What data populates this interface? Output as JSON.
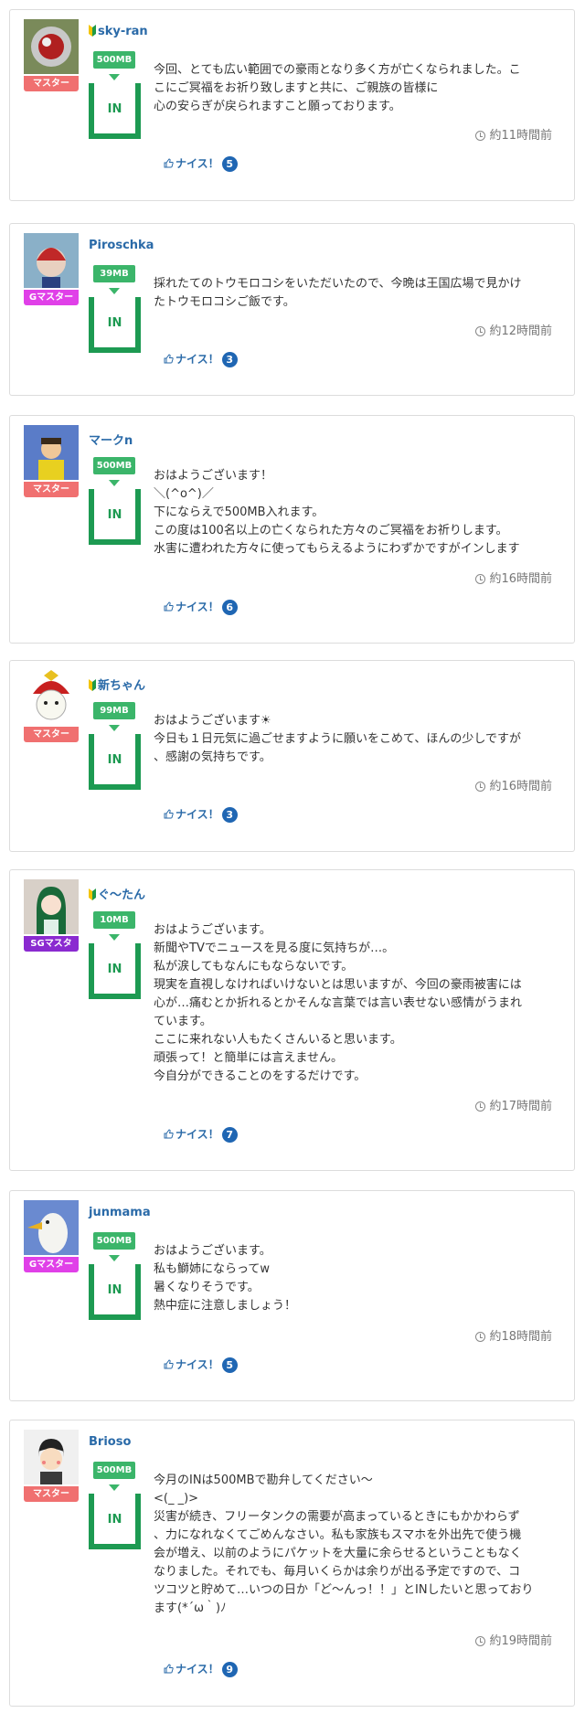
{
  "labels": {
    "nice": "ナイス！",
    "in": "IN"
  },
  "colors": {
    "master": "#f07070",
    "gmaster": "#e040e8",
    "sgmaster": "#8a2ad0",
    "in_green": "#1d9a52",
    "link_blue": "#2a6aa8"
  },
  "posts": [
    {
      "user": "sky-ran",
      "beginner": true,
      "rank": "マスター",
      "rank_color": "master",
      "mb": "500MB",
      "message": "今回、とても広い範囲での豪雨となり多く方が亡くなられました。こ\nこにご冥福をお祈り致しますと共に、ご親族の皆様に\n心の安らぎが戻られますこと願っております。",
      "time": "約11時間前",
      "nice_count": "5"
    },
    {
      "user": "Piroschka",
      "beginner": false,
      "rank": "Gマスター",
      "rank_color": "gmaster",
      "mb": "39MB",
      "message": "採れたてのトウモロコシをいただいたので、今晩は王国広場で見かけ\nたトウモロコシご飯です。",
      "time": "約12時間前",
      "nice_count": "3"
    },
    {
      "user": "マークn",
      "beginner": false,
      "rank": "マスター",
      "rank_color": "master",
      "mb": "500MB",
      "message": "おはようございます！\n＼(^o^)／\n下にならえで500MB入れます。\nこの度は100名以上の亡くなられた方々のご冥福をお祈りします。\n水害に遭われた方々に使ってもらえるようにわずかですがインします",
      "time": "約16時間前",
      "nice_count": "6"
    },
    {
      "user": "新ちゃん",
      "beginner": true,
      "rank": "マスター",
      "rank_color": "master",
      "mb": "99MB",
      "message": "おはようございます☀\n今日も１日元気に過ごせますように願いをこめて、ほんの少しですが\n、感謝の気持ちです。",
      "time": "約16時間前",
      "nice_count": "3"
    },
    {
      "user": "ぐ〜たん",
      "beginner": true,
      "rank": "SGマスタ",
      "rank_color": "sgmaster",
      "mb": "10MB",
      "message": "おはようございます。\n新聞やTVでニュースを見る度に気持ちが…。\n私が涙してもなんにもならないです。\n現実を直視しなければいけないとは思いますが、今回の豪雨被害には\n心が…痛むとか折れるとかそんな言葉では言い表せない感情がうまれ\nています。\nここに来れない人もたくさんいると思います。\n頑張って！と簡単には言えません。\n今自分ができることのをするだけです。",
      "time": "約17時間前",
      "nice_count": "7"
    },
    {
      "user": "junmama",
      "beginner": false,
      "rank": "Gマスター",
      "rank_color": "gmaster",
      "mb": "500MB",
      "message": "おはようございます。\n私も鰤姉にならってw\n暑くなりそうです。\n熱中症に注意しましょう！",
      "time": "約18時間前",
      "nice_count": "5"
    },
    {
      "user": "Brioso",
      "beginner": false,
      "rank": "マスター",
      "rank_color": "master",
      "mb": "500MB",
      "message": "今月のINは500MBで勘弁してください〜\n<(_ _)>\n災害が続き、フリータンクの需要が高まっているときにもかかわらず\n、力になれなくてごめんなさい。私も家族もスマホを外出先で使う機\n会が増え、以前のようにパケットを大量に余らせるということもなく\nなりました。それでも、毎月いくらかは余りが出る予定ですので、コ\nツコツと貯めて…いつの日か「ど〜んっ！！」とINしたいと思っており\nます(*´ω｀)ﾉ",
      "time": "約19時間前",
      "nice_count": "9"
    }
  ]
}
